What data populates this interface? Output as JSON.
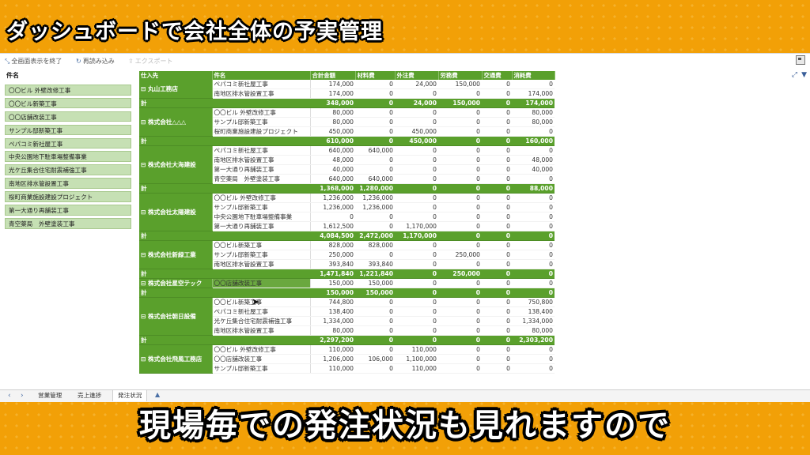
{
  "headline": "ダッシュボードで会社全体の予実管理",
  "caption": "現場毎での発注状況も見れますので",
  "toolbar": {
    "exit_fullscreen": "全画面表示を終了",
    "reload": "再読み込み",
    "export": "エクスポート"
  },
  "filter": {
    "title": "件名",
    "items": [
      "〇〇ビル 外壁改修工事",
      "〇〇ビル新築工事",
      "〇〇店舗改装工事",
      "サンプル邸新築工事",
      "ペパコミ新社屋工事",
      "中央公園地下駐車場整備事業",
      "光ケ丘集合住宅耐震補強工事",
      "南地区排水管設置工事",
      "桜町商業施設建設プロジェクト",
      "第一大通り再舗装工事",
      "青空薬局　外壁塗装工事"
    ]
  },
  "table": {
    "headers": [
      "仕入先",
      "件名",
      "合計金額",
      "材料費",
      "外注費",
      "労務費",
      "交通費",
      "消耗費"
    ],
    "total_label": "計",
    "groups": [
      {
        "vendor": "丸山工務店",
        "rows": [
          [
            "ペパコミ新社屋工事",
            "174,000",
            "0",
            "24,000",
            "150,000",
            "0",
            "0"
          ],
          [
            "南地区排水管設置工事",
            "174,000",
            "0",
            "0",
            "0",
            "0",
            "174,000"
          ]
        ],
        "total": [
          "348,000",
          "0",
          "24,000",
          "150,000",
          "0",
          "174,000"
        ]
      },
      {
        "vendor": "株式会社△△△",
        "rows": [
          [
            "〇〇ビル 外壁改修工事",
            "80,000",
            "0",
            "0",
            "0",
            "0",
            "80,000"
          ],
          [
            "サンプル邸新築工事",
            "80,000",
            "0",
            "0",
            "0",
            "0",
            "80,000"
          ],
          [
            "桜町商業施設建設プロジェクト",
            "450,000",
            "0",
            "450,000",
            "0",
            "0",
            "0"
          ]
        ],
        "total": [
          "610,000",
          "0",
          "450,000",
          "0",
          "0",
          "160,000"
        ]
      },
      {
        "vendor": "株式会社大海建設",
        "rows": [
          [
            "ペパコミ新社屋工事",
            "640,000",
            "640,000",
            "0",
            "0",
            "0",
            "0"
          ],
          [
            "南地区排水管設置工事",
            "48,000",
            "0",
            "0",
            "0",
            "0",
            "48,000"
          ],
          [
            "第一大通り再舗装工事",
            "40,000",
            "0",
            "0",
            "0",
            "0",
            "40,000"
          ],
          [
            "青空薬局　外壁塗装工事",
            "640,000",
            "640,000",
            "0",
            "0",
            "0",
            "0"
          ]
        ],
        "total": [
          "1,368,000",
          "1,280,000",
          "0",
          "0",
          "0",
          "88,000"
        ]
      },
      {
        "vendor": "株式会社太陽建設",
        "rows": [
          [
            "〇〇ビル 外壁改修工事",
            "1,236,000",
            "1,236,000",
            "0",
            "0",
            "0",
            "0"
          ],
          [
            "サンプル邸新築工事",
            "1,236,000",
            "1,236,000",
            "0",
            "0",
            "0",
            "0"
          ],
          [
            "中央公園地下駐車場整備事業",
            "0",
            "0",
            "0",
            "0",
            "0",
            "0"
          ],
          [
            "第一大通り再舗装工事",
            "1,612,500",
            "0",
            "1,170,000",
            "0",
            "0",
            "0"
          ]
        ],
        "total": [
          "4,084,500",
          "2,472,000",
          "1,170,000",
          "0",
          "0",
          "0"
        ]
      },
      {
        "vendor": "株式会社新緑工業",
        "rows": [
          [
            "〇〇ビル新築工事",
            "828,000",
            "828,000",
            "0",
            "0",
            "0",
            "0"
          ],
          [
            "サンプル邸新築工事",
            "250,000",
            "0",
            "0",
            "250,000",
            "0",
            "0"
          ],
          [
            "南地区排水管設置工事",
            "393,840",
            "393,840",
            "0",
            "0",
            "0",
            "0"
          ]
        ],
        "total": [
          "1,471,840",
          "1,221,840",
          "0",
          "250,000",
          "0",
          "0"
        ]
      },
      {
        "vendor": "株式会社星空テック",
        "rows": [
          [
            "〇〇店舗改装工事",
            "150,000",
            "150,000",
            "0",
            "0",
            "0",
            "0"
          ]
        ],
        "total": [
          "150,000",
          "150,000",
          "0",
          "0",
          "0",
          "0"
        ]
      },
      {
        "vendor": "株式会社朝日設備",
        "rows": [
          [
            "〇〇ビル新築工事",
            "744,800",
            "0",
            "0",
            "0",
            "0",
            "750,800"
          ],
          [
            "ペパコミ新社屋工事",
            "138,400",
            "0",
            "0",
            "0",
            "0",
            "138,400"
          ],
          [
            "光ケ丘集合住宅耐震補強工事",
            "1,334,000",
            "0",
            "0",
            "0",
            "0",
            "1,334,000"
          ],
          [
            "南地区排水管設置工事",
            "80,000",
            "0",
            "0",
            "0",
            "0",
            "80,000"
          ]
        ],
        "total": [
          "2,297,200",
          "0",
          "0",
          "0",
          "0",
          "2,303,200"
        ]
      },
      {
        "vendor": "株式会社飛風工務店",
        "rows": [
          [
            "〇〇ビル 外壁改修工事",
            "110,000",
            "0",
            "110,000",
            "0",
            "0",
            "0"
          ],
          [
            "〇〇店舗改装工事",
            "1,206,000",
            "106,000",
            "1,100,000",
            "0",
            "0",
            "0"
          ],
          [
            "サンプル邸新築工事",
            "110,000",
            "0",
            "110,000",
            "0",
            "0",
            "0"
          ]
        ],
        "total": null
      }
    ]
  },
  "tabs": [
    "営業管理",
    "売上進捗",
    "発注状況"
  ],
  "active_tab": "発注状況"
}
